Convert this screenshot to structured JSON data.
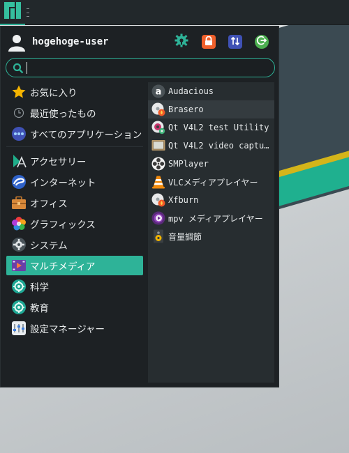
{
  "user": {
    "name": "hogehoge-user"
  },
  "search": {
    "value": "",
    "placeholder": ""
  },
  "actions": [
    {
      "name": "settings-gear-icon",
      "color": "#2eb398"
    },
    {
      "name": "lock-icon",
      "color": "#f0602b"
    },
    {
      "name": "switch-user-icon",
      "color": "#3f51b5"
    },
    {
      "name": "logout-icon",
      "color": "#4caf50"
    }
  ],
  "categories": [
    {
      "label": "お気に入り",
      "icon": "star-icon"
    },
    {
      "label": "最近使ったもの",
      "icon": "clock-icon"
    },
    {
      "label": "すべてのアプリケーション",
      "icon": "dots-icon"
    },
    {
      "label": "アクセサリー",
      "icon": "accessories-icon"
    },
    {
      "label": "インターネット",
      "icon": "globe-icon"
    },
    {
      "label": "オフィス",
      "icon": "briefcase-icon"
    },
    {
      "label": "グラフィックス",
      "icon": "graphics-icon"
    },
    {
      "label": "システム",
      "icon": "system-gear-icon"
    },
    {
      "label": "マルチメディア",
      "icon": "multimedia-icon",
      "selected": true
    },
    {
      "label": "科学",
      "icon": "science-icon"
    },
    {
      "label": "教育",
      "icon": "education-icon"
    },
    {
      "label": "設定マネージャー",
      "icon": "settings-manager-icon"
    }
  ],
  "apps": [
    {
      "label": "Audacious",
      "icon": "audacious-icon"
    },
    {
      "label": "Brasero",
      "icon": "brasero-icon",
      "hover": true
    },
    {
      "label": "Qt V4L2 test Utility",
      "icon": "qv4l2-icon"
    },
    {
      "label": "Qt V4L2 video captu…",
      "icon": "qvidcap-icon"
    },
    {
      "label": "SMPlayer",
      "icon": "smplayer-icon"
    },
    {
      "label": "VLCメディアプレイヤー",
      "icon": "vlc-icon"
    },
    {
      "label": "Xfburn",
      "icon": "xfburn-icon"
    },
    {
      "label": "mpv メディアプレイヤー",
      "icon": "mpv-icon"
    },
    {
      "label": "音量調節",
      "icon": "volume-control-icon"
    }
  ],
  "colors": {
    "accent": "#2eb398",
    "menu_bg": "#1d2124",
    "app_pane_bg": "#272d30"
  }
}
